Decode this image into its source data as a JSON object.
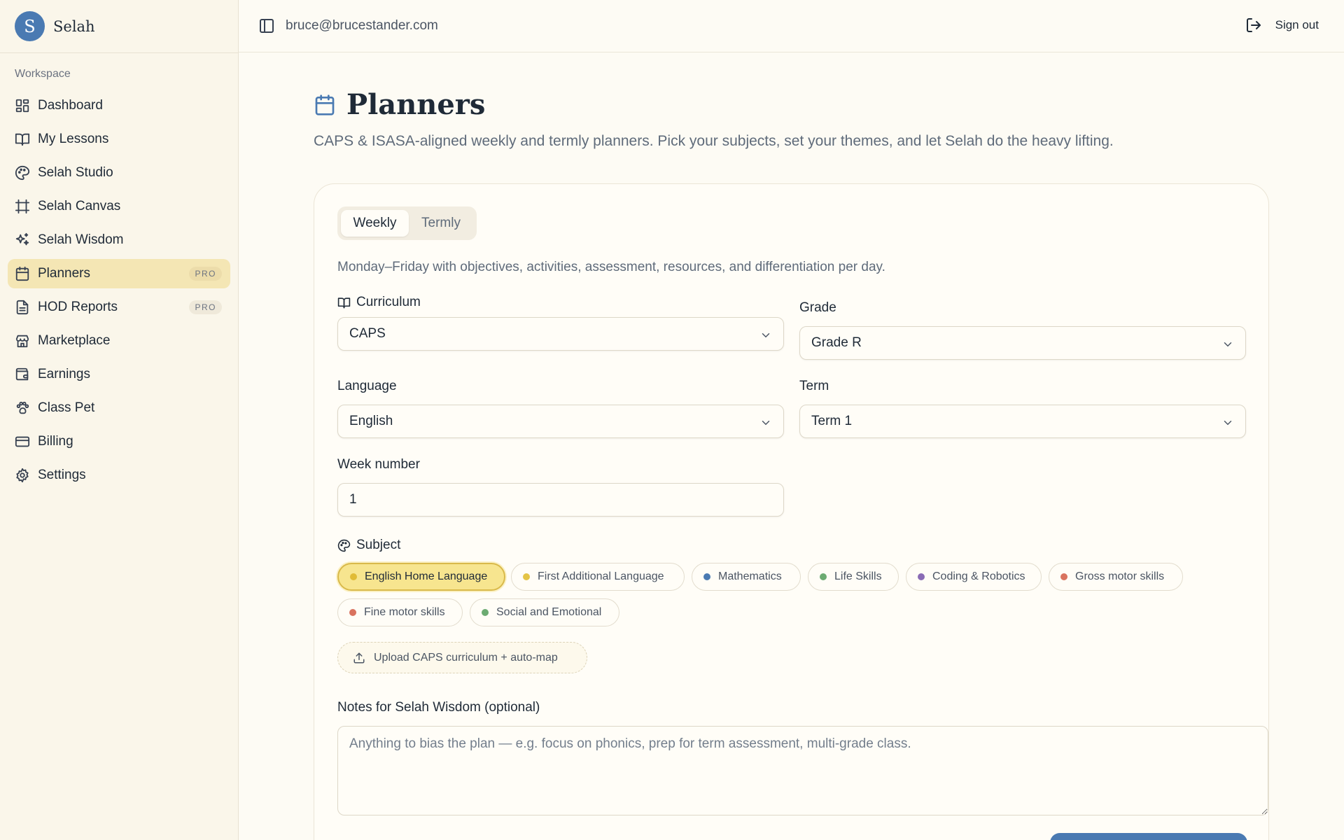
{
  "brand": {
    "logo_letter": "S",
    "name": "Selah",
    "accent": "#4a7ab2"
  },
  "sidebar": {
    "section_label": "Workspace",
    "items": [
      {
        "label": "Dashboard",
        "icon": "dashboard-icon"
      },
      {
        "label": "My Lessons",
        "icon": "book-open-icon"
      },
      {
        "label": "Selah Studio",
        "icon": "palette-icon"
      },
      {
        "label": "Selah Canvas",
        "icon": "frame-icon"
      },
      {
        "label": "Selah Wisdom",
        "icon": "sparkles-icon"
      },
      {
        "label": "Planners",
        "icon": "calendar-icon",
        "badge": "PRO",
        "active": true
      },
      {
        "label": "HOD Reports",
        "icon": "file-text-icon",
        "badge": "PRO"
      },
      {
        "label": "Marketplace",
        "icon": "store-icon"
      },
      {
        "label": "Earnings",
        "icon": "wallet-icon"
      },
      {
        "label": "Class Pet",
        "icon": "paw-icon"
      },
      {
        "label": "Billing",
        "icon": "credit-card-icon"
      },
      {
        "label": "Settings",
        "icon": "gear-icon"
      }
    ]
  },
  "topbar": {
    "email": "bruce@brucestander.com",
    "signout_label": "Sign out"
  },
  "page": {
    "title": "Planners",
    "subtitle": "CAPS & ISASA-aligned weekly and termly planners. Pick your subjects, set your themes, and let Selah do the heavy lifting."
  },
  "form": {
    "tabs": {
      "weekly": "Weekly",
      "termly": "Termly",
      "selected": "Weekly"
    },
    "mode_description": "Monday–Friday with objectives, activities, assessment, resources, and differentiation per day.",
    "curriculum": {
      "label": "Curriculum",
      "value": "CAPS"
    },
    "grade": {
      "label": "Grade",
      "value": "Grade R"
    },
    "language": {
      "label": "Language",
      "value": "English"
    },
    "term": {
      "label": "Term",
      "value": "Term 1"
    },
    "week": {
      "label": "Week number",
      "value": "1"
    },
    "subject": {
      "label": "Subject",
      "chips": [
        {
          "label": "English Home Language",
          "color": "#e0bb36",
          "selected": true
        },
        {
          "label": "First Additional Language",
          "color": "#e4c446"
        },
        {
          "label": "Mathematics",
          "color": "#4a7ab2"
        },
        {
          "label": "Life Skills",
          "color": "#6cab72"
        },
        {
          "label": "Coding & Robotics",
          "color": "#8a6bb5"
        },
        {
          "label": "Gross motor skills",
          "color": "#d9735f"
        },
        {
          "label": "Fine motor skills",
          "color": "#d9735f"
        },
        {
          "label": "Social and Emotional",
          "color": "#6cab72"
        }
      ]
    },
    "upload_label": "Upload CAPS curriculum + auto-map",
    "notes": {
      "label": "Notes for Selah Wisdom (optional)",
      "placeholder": "Anything to bias the plan — e.g. focus on phonics, prep for term assessment, multi-grade class."
    }
  }
}
